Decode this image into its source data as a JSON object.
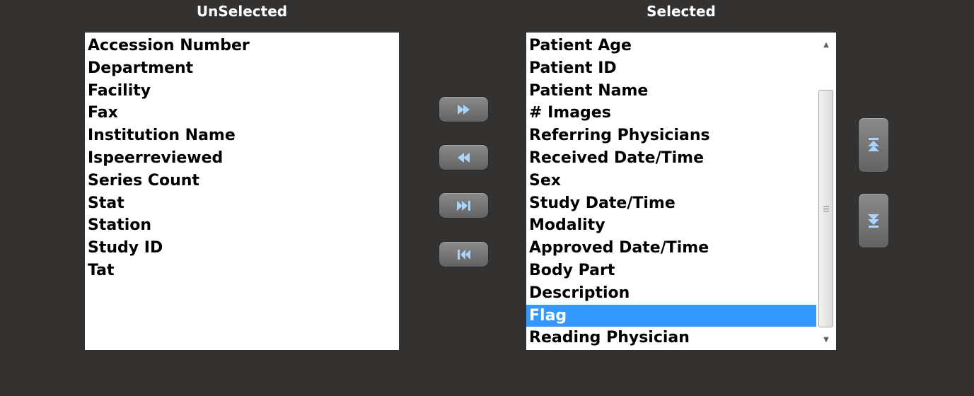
{
  "unselected": {
    "header": "UnSelected",
    "items": [
      "Accession Number",
      "Department",
      "Facility",
      "Fax",
      "Institution Name",
      "Ispeerreviewed",
      "Series Count",
      "Stat",
      "Station",
      "Study ID",
      "Tat"
    ]
  },
  "selected": {
    "header": "Selected",
    "selected_item": "Flag",
    "items": [
      "Patient Age",
      "Patient ID",
      "Patient Name",
      "# Images",
      "Referring Physicians",
      "Received Date/Time",
      "Sex",
      "Study Date/Time",
      "Modality",
      "Approved Date/Time",
      "Body Part",
      "Description",
      "Flag",
      "Reading Physician"
    ]
  },
  "transfer_buttons": {
    "move_right_icon": "double-arrow-right-icon",
    "move_left_icon": "double-arrow-left-icon",
    "move_all_right_icon": "skip-forward-icon",
    "move_all_left_icon": "skip-back-icon"
  },
  "order_buttons": {
    "move_up_icon": "double-chevron-up-icon",
    "move_down_icon": "double-chevron-down-icon"
  },
  "colors": {
    "background": "#333230",
    "highlight": "#3399ff",
    "icon": "#a9d4ff"
  }
}
